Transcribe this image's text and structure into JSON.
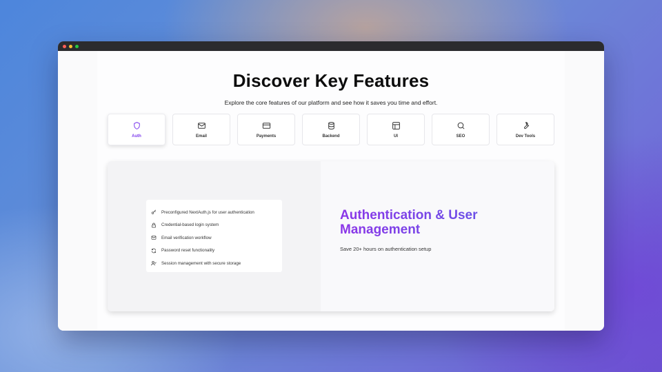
{
  "window": {
    "controls": [
      "close",
      "minimize",
      "maximize"
    ]
  },
  "hero": {
    "title": "Discover Key Features",
    "subtitle": "Explore the core features of our platform and see how it saves you time and effort."
  },
  "tabs": [
    {
      "label": "Auth",
      "icon": "shield-icon",
      "active": true
    },
    {
      "label": "Email",
      "icon": "mail-icon",
      "active": false
    },
    {
      "label": "Payments",
      "icon": "credit-card-icon",
      "active": false
    },
    {
      "label": "Backend",
      "icon": "database-icon",
      "active": false
    },
    {
      "label": "UI",
      "icon": "layout-icon",
      "active": false
    },
    {
      "label": "SEO",
      "icon": "search-icon",
      "active": false
    },
    {
      "label": "Dev Tools",
      "icon": "wrench-icon",
      "active": false
    }
  ],
  "panel": {
    "title": "Authentication & User Management",
    "subtitle": "Save 20+ hours on authentication setup",
    "features": [
      {
        "text": "Preconfigured NextAuth.js for user authentication",
        "icon": "key-icon"
      },
      {
        "text": "Credential-based login system",
        "icon": "lock-icon"
      },
      {
        "text": "Email verification workflow",
        "icon": "mail-icon"
      },
      {
        "text": "Password reset functionality",
        "icon": "refresh-icon"
      },
      {
        "text": "Session management with secure storage",
        "icon": "user-check-icon"
      }
    ]
  },
  "colors": {
    "accent": "#7c3aed",
    "accent_end": "#5b5de6",
    "text": "#0d0d0d"
  }
}
